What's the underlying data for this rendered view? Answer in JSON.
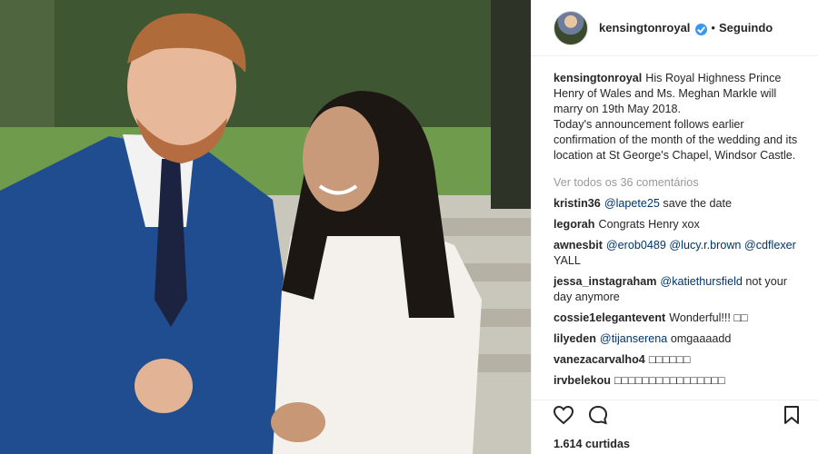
{
  "post": {
    "username": "kensingtonroyal",
    "follow_separator": "•",
    "follow_status": "Seguindo",
    "caption_author": "kensingtonroyal",
    "caption_text": "His Royal Highness Prince Henry of Wales and Ms. Meghan Markle will marry on 19th May 2018.\nToday's announcement follows earlier confirmation of the month of the wedding and its location at St George's Chapel, Windsor Castle.",
    "view_all_comments": "Ver todos os 36 comentários",
    "likes": "1.614 curtidas"
  },
  "comments": [
    {
      "author": "kristin36",
      "mention": "@lapete25",
      "text": "save the date"
    },
    {
      "author": "legorah",
      "mention": "",
      "text": "Congrats Henry xox"
    },
    {
      "author": "awnesbit",
      "mention": "@erob0489 @lucy.r.brown @cdflexer",
      "text": "YALL"
    },
    {
      "author": "jessa_instagraham",
      "mention": "@katiethursfield",
      "text": "not your day anymore"
    },
    {
      "author": "cossie1elegantevent",
      "mention": "",
      "text": "Wonderful!!! □□"
    },
    {
      "author": "lilyeden",
      "mention": "@tijanserena",
      "text": "omgaaaadd"
    },
    {
      "author": "vanezacarvalho4",
      "mention": "",
      "text": "□□□□□□"
    },
    {
      "author": "irvbelekou",
      "mention": "",
      "text": "□□□□□□□□□□□□□□□□"
    }
  ],
  "icons": {
    "like": "heart-icon",
    "comment": "comment-icon",
    "save": "bookmark-icon",
    "verified": "verified-badge-icon"
  },
  "colors": {
    "verified": "#3897f0",
    "mention": "#003569",
    "muted": "#999999",
    "text": "#262626"
  }
}
